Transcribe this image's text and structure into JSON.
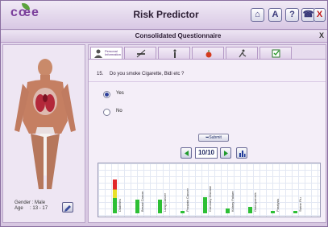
{
  "app": {
    "title": "Risk Predictor",
    "logo_text": "cœe"
  },
  "toolbar": {
    "home_label": "⌂",
    "user_label": "A",
    "help_label": "?",
    "phone_label": "☎",
    "close_label": "X"
  },
  "questionnaire": {
    "title": "Consolidated Questionnaire",
    "close_label": "X"
  },
  "tabs": [
    {
      "label": "Personal Information",
      "icon": "person-icon"
    },
    {
      "label": "",
      "icon": "no-smoking-icon"
    },
    {
      "label": "",
      "icon": "standing-figure-icon"
    },
    {
      "label": "",
      "icon": "food-icon"
    },
    {
      "label": "",
      "icon": "runner-icon"
    },
    {
      "label": "",
      "icon": "checklist-icon"
    }
  ],
  "question": {
    "number": "15.",
    "text": "Do you smoke Cigarette, Bidi etc ?"
  },
  "options": [
    {
      "label": "Yes",
      "selected": true
    },
    {
      "label": "No",
      "selected": false
    }
  ],
  "submit_label": "Submit",
  "pager": {
    "value": "10/10"
  },
  "patient": {
    "gender_label": "Gender",
    "gender": "Male",
    "age_label": "Age",
    "age": "13 - 17"
  },
  "risk_bars": [
    {
      "label": "Diabetes",
      "level": 0.75,
      "color": "multi"
    },
    {
      "label": "Breast Cancer",
      "level": 0.3,
      "color": "#2dbf35"
    },
    {
      "label": "Lung Cancer",
      "level": 0.3,
      "color": "#2dbf35"
    },
    {
      "label": "Prostate Cancer",
      "level": 0.05,
      "color": "#2dbf35"
    },
    {
      "label": "Coronary Disease",
      "level": 0.35,
      "color": "#2dbf35"
    },
    {
      "label": "Kidney Failure",
      "level": 0.1,
      "color": "#2dbf35"
    },
    {
      "label": "Osteoporosis",
      "level": 0.15,
      "color": "#2dbf35"
    },
    {
      "label": "Paralysis",
      "level": 0.05,
      "color": "#2dbf35"
    },
    {
      "label": "Swine Flu",
      "level": 0.05,
      "color": "#2dbf35"
    }
  ]
}
